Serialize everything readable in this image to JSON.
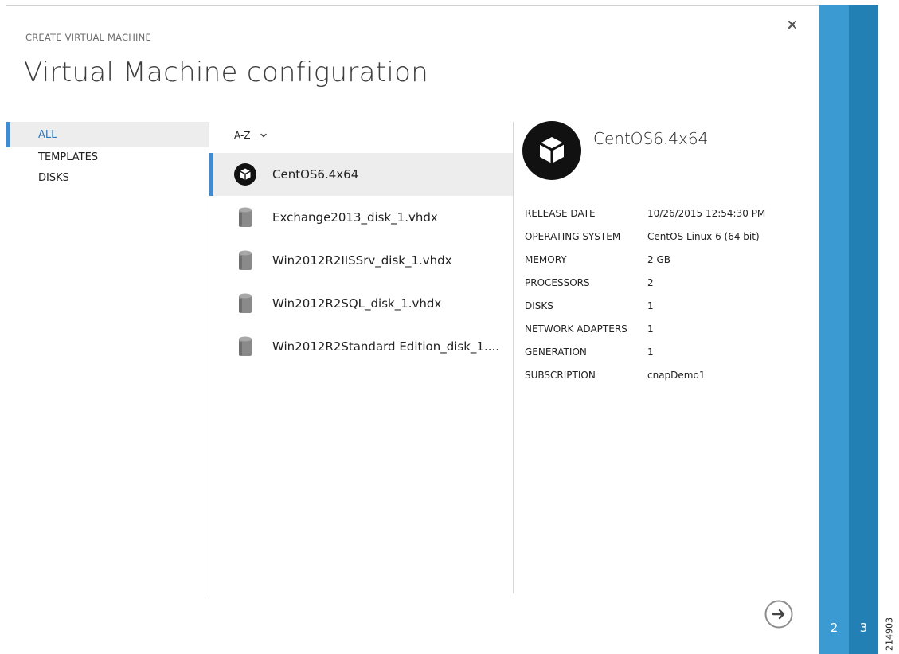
{
  "header": {
    "eyebrow": "CREATE VIRTUAL MACHINE",
    "title": "Virtual Machine configuration"
  },
  "nav": {
    "items": [
      {
        "label": "ALL",
        "active": true
      },
      {
        "label": "TEMPLATES",
        "active": false
      },
      {
        "label": "DISKS",
        "active": false
      }
    ]
  },
  "list": {
    "sort_label": "A-Z",
    "items": [
      {
        "label": "CentOS6.4x64",
        "icon": "template-cube-icon",
        "selected": true
      },
      {
        "label": "Exchange2013_disk_1.vhdx",
        "icon": "disk-icon",
        "selected": false
      },
      {
        "label": "Win2012R2IISSrv_disk_1.vhdx",
        "icon": "disk-icon",
        "selected": false
      },
      {
        "label": "Win2012R2SQL_disk_1.vhdx",
        "icon": "disk-icon",
        "selected": false
      },
      {
        "label": "Win2012R2Standard Edition_disk_1....",
        "icon": "disk-icon",
        "selected": false
      }
    ]
  },
  "detail": {
    "name": "CentOS6.4x64",
    "properties": [
      {
        "key": "RELEASE DATE",
        "value": "10/26/2015 12:54:30 PM"
      },
      {
        "key": "OPERATING SYSTEM",
        "value": "CentOS Linux 6 (64 bit)"
      },
      {
        "key": "MEMORY",
        "value": "2 GB"
      },
      {
        "key": "PROCESSORS",
        "value": "2"
      },
      {
        "key": "DISKS",
        "value": "1"
      },
      {
        "key": "NETWORK ADAPTERS",
        "value": "1"
      },
      {
        "key": "GENERATION",
        "value": "1"
      },
      {
        "key": "SUBSCRIPTION",
        "value": "cnapDemo1"
      }
    ]
  },
  "steps": [
    {
      "label": "2",
      "color": "#3b9ad1"
    },
    {
      "label": "3",
      "color": "#2380b5"
    }
  ],
  "figure_number": "214903",
  "colors": {
    "accent": "#3c8dd6",
    "selection_bg": "#ededed"
  }
}
